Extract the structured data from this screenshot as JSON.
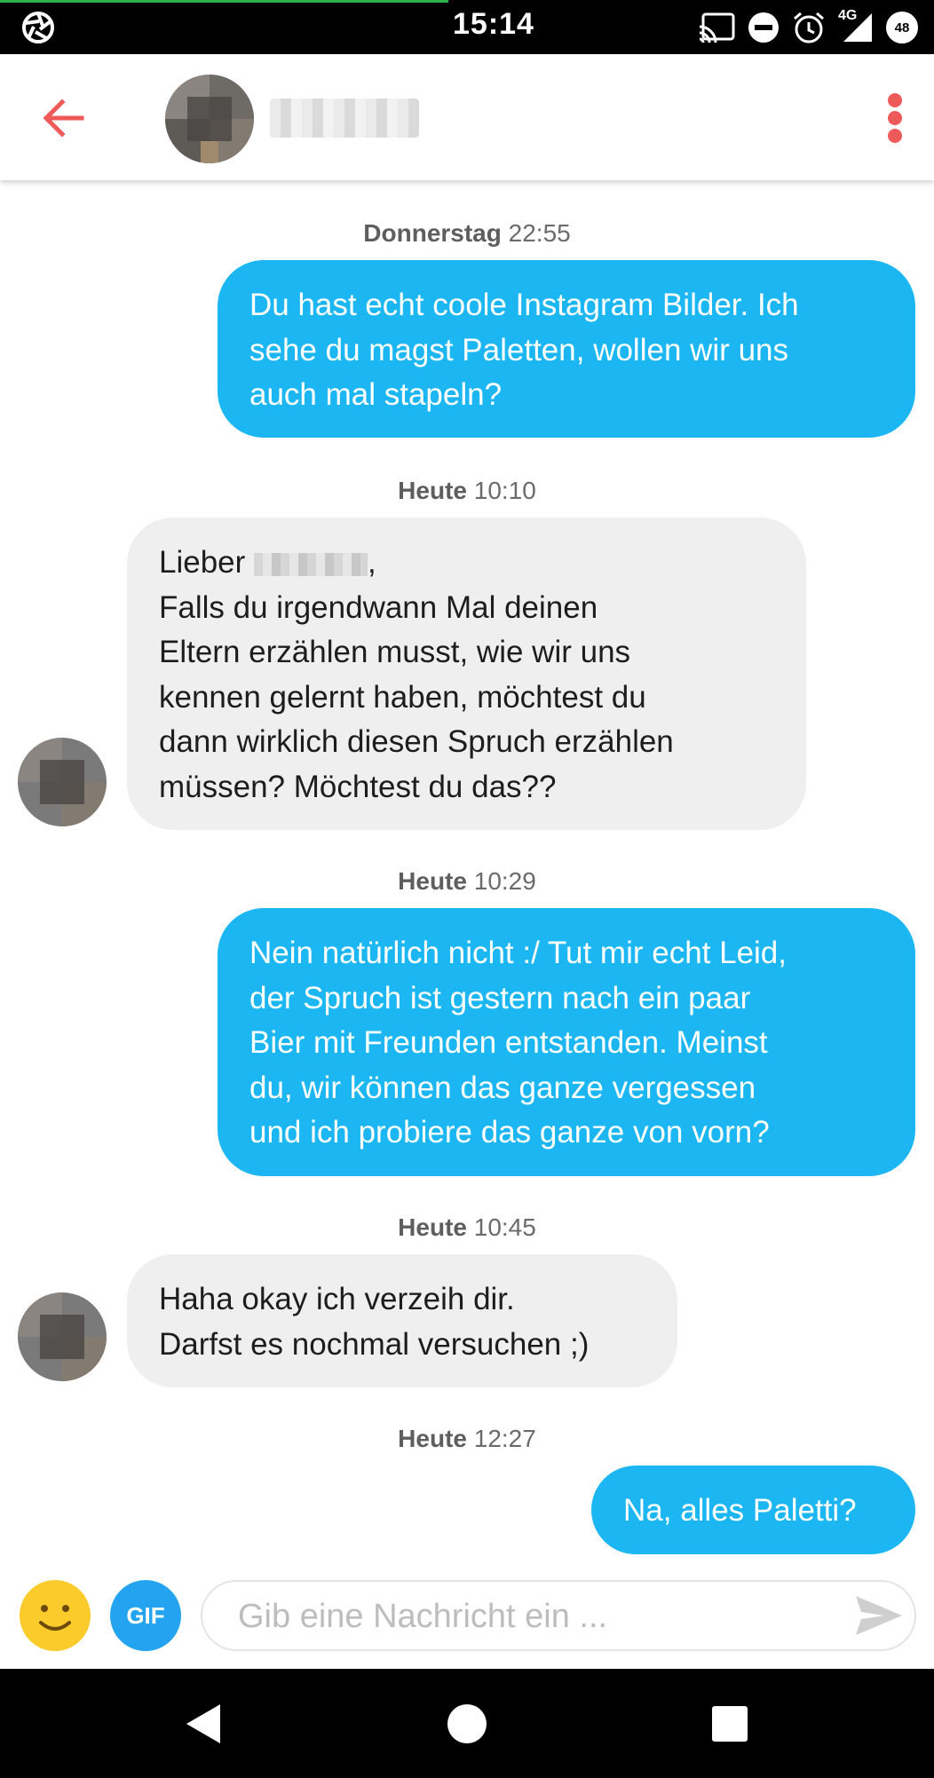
{
  "status_bar": {
    "time": "15:14",
    "network": "4G",
    "battery": "48",
    "icons": [
      "aperture-icon",
      "cast-icon",
      "do-not-disturb-icon",
      "alarm-icon",
      "signal-icon",
      "battery-icon"
    ]
  },
  "header": {
    "back_icon": "arrow-left-icon",
    "menu_icon": "more-vertical-icon"
  },
  "messages": [
    {
      "timestamp_day": "Donnerstag",
      "timestamp_time": "22:55",
      "direction": "outgoing",
      "lines": [
        "Du hast echt coole Instagram Bilder. Ich",
        "sehe du magst Paletten, wollen wir uns",
        "auch mal stapeln?"
      ]
    },
    {
      "timestamp_day": "Heute",
      "timestamp_time": "10:10",
      "direction": "incoming",
      "lines": [
        "Lieber",
        "Falls du irgendwann Mal deinen",
        "Eltern erzählen musst, wie wir uns",
        "kennen gelernt haben, möchtest du",
        "dann wirklich diesen Spruch erzählen",
        "müssen? Möchtest du das??"
      ]
    },
    {
      "timestamp_day": "Heute",
      "timestamp_time": "10:29",
      "direction": "outgoing",
      "lines": [
        "Nein natürlich nicht :/ Tut mir echt Leid,",
        "der Spruch ist gestern nach ein paar",
        "Bier mit Freunden entstanden. Meinst",
        "du, wir können das ganze vergessen",
        "und ich probiere das ganze von vorn?"
      ]
    },
    {
      "timestamp_day": "Heute",
      "timestamp_time": "10:45",
      "direction": "incoming",
      "lines": [
        "Haha okay ich verzeih dir.",
        "Darfst es nochmal versuchen ;)"
      ]
    },
    {
      "timestamp_day": "Heute",
      "timestamp_time": "12:27",
      "direction": "outgoing",
      "lines": [
        "Na, alles Paletti?"
      ]
    }
  ],
  "composer": {
    "emoji_icon": "smiley-icon",
    "gif_label": "GIF",
    "placeholder": "Gib eine Nachricht ein ...",
    "value": "",
    "send_icon": "send-icon"
  },
  "nav_bar": {
    "icons": [
      "back-triangle-icon",
      "home-circle-icon",
      "recents-square-icon"
    ]
  },
  "colors": {
    "accent": "#ee5a5a",
    "outgoing_bubble": "#1cb7f2",
    "incoming_bubble": "#efefef",
    "gif_button": "#24a4f0",
    "emoji_button": "#fbcb2c"
  }
}
